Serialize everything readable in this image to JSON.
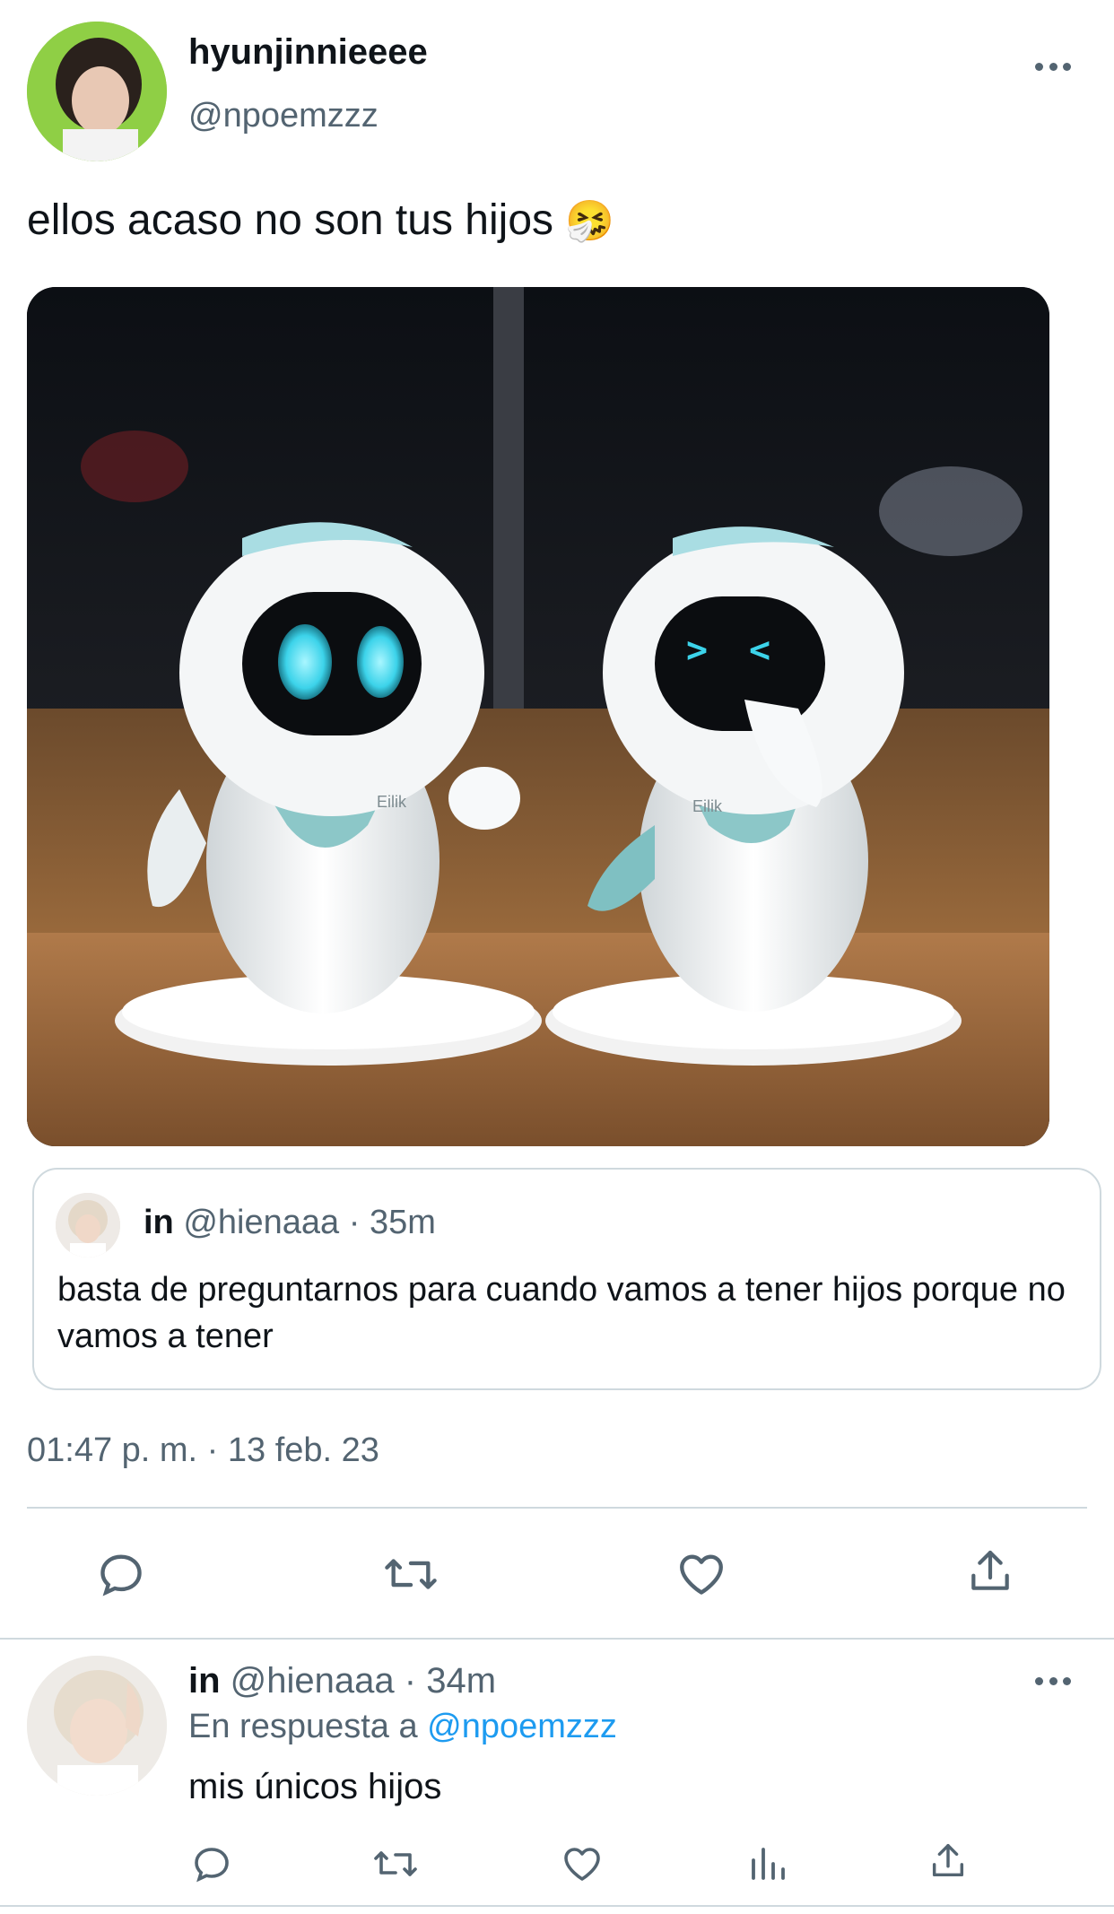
{
  "tweet": {
    "author_name": "hyunjinnieeee",
    "author_handle": "@npoemzzz",
    "text": "ellos acaso no son tus hijos",
    "emoji": "🤧",
    "image_text_left": "Eilik",
    "image_text_right": "Eilik",
    "quote": {
      "name": "in",
      "handle": "@hienaaa",
      "separator": "·",
      "time": "35m",
      "text": "basta de preguntarnos para cuando vamos a tener hijos porque no vamos a tener"
    },
    "timestamp": "01:47 p. m. · 13 feb. 23"
  },
  "reply": {
    "name": "in",
    "handle": "@hienaaa",
    "separator": "·",
    "time": "34m",
    "reply_prefix": "En respuesta a",
    "reply_to": "@npoemzzz",
    "text": "mis únicos hijos"
  },
  "icons": {
    "reply": "comment-icon",
    "retweet": "retweet-icon",
    "like": "heart-icon",
    "share": "share-icon",
    "analytics": "analytics-icon",
    "more": "more-icon"
  },
  "colors": {
    "text": "#0f1419",
    "muted": "#536471",
    "link": "#1d9bf0",
    "divider": "#cfd9de"
  }
}
